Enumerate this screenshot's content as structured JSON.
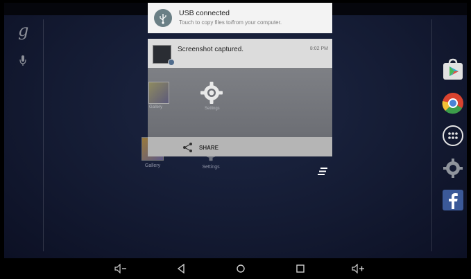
{
  "notifications": {
    "usb": {
      "title": "USB connected",
      "subtitle": "Touch to copy files to/from your computer."
    },
    "screenshot": {
      "title": "Screenshot captured.",
      "time": "8:02 PM",
      "preview_gallery_label": "Gallery",
      "preview_settings_label": "Settings",
      "share_label": "SHARE"
    }
  },
  "desktop": {
    "gallery_label": "Gallery",
    "settings_label": "Settings",
    "google_letter": "g"
  },
  "colors": {
    "wallpaper": "#141b33",
    "notification_bg": "#f3f3f3",
    "shade_bg": "#c7c7c7",
    "chrome_red": "#d9432f",
    "facebook_blue": "#3b5998"
  },
  "icons": {
    "usb": "usb-icon",
    "share": "share-icon",
    "clear_all": "clear-all-icon",
    "play_store": "play-store-icon",
    "chrome": "chrome-icon",
    "app_drawer": "app-drawer-icon",
    "settings": "settings-gear-icon",
    "facebook": "facebook-icon"
  }
}
